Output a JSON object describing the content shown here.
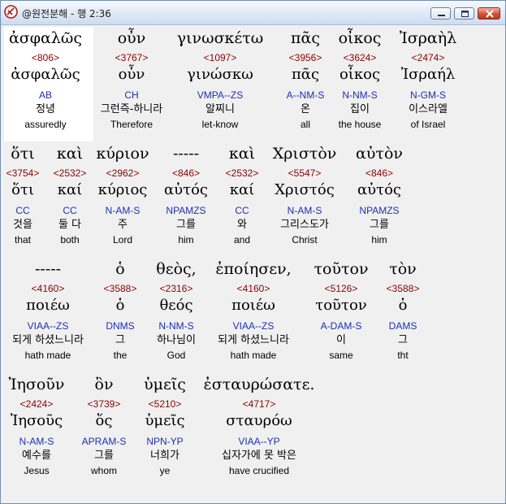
{
  "window": {
    "title": "@원전분해 - 행 2:36",
    "buttons": {
      "minimize": "minimize",
      "maximize": "maximize",
      "close": "close"
    }
  },
  "words": [
    {
      "greek": "ἀσφαλῶς",
      "strong": "<806>",
      "lexeme": "ἀσφαλῶς",
      "parse": "AB",
      "korean": "정녕",
      "english": "assuredly"
    },
    {
      "greek": "οὖν",
      "strong": "<3767>",
      "lexeme": "οὖν",
      "parse": "CH",
      "korean": "그런즉-하니라",
      "english": "Therefore"
    },
    {
      "greek": "γινωσκέτω",
      "strong": "<1097>",
      "lexeme": "γινώσκω",
      "parse": "VMPA--ZS",
      "korean": "알찌니",
      "english": "let-know"
    },
    {
      "greek": "πᾶς",
      "strong": "<3956>",
      "lexeme": "πᾶς",
      "parse": "A--NM-S",
      "korean": "온",
      "english": "all"
    },
    {
      "greek": "οἶκος",
      "strong": "<3624>",
      "lexeme": "οἶκος",
      "parse": "N-NM-S",
      "korean": "집이",
      "english": "the house"
    },
    {
      "greek": "Ἰσραὴλ",
      "strong": "<2474>",
      "lexeme": "Ἰσραήλ",
      "parse": "N-GM-S",
      "korean": "이스라엘",
      "english": "of Israel"
    },
    {
      "greek": "ὅτι",
      "strong": "<3754>",
      "lexeme": "ὅτι",
      "parse": "CC",
      "korean": "것을",
      "english": "that"
    },
    {
      "greek": "καὶ",
      "strong": "<2532>",
      "lexeme": "καί",
      "parse": "CC",
      "korean": "둘 다",
      "english": "both"
    },
    {
      "greek": "κύριον",
      "strong": "<2962>",
      "lexeme": "κύριος",
      "parse": "N-AM-S",
      "korean": "주",
      "english": "Lord"
    },
    {
      "greek": "-----",
      "strong": "<846>",
      "lexeme": "αὐτός",
      "parse": "NPAMZS",
      "korean": "그를",
      "english": "him"
    },
    {
      "greek": "καὶ",
      "strong": "<2532>",
      "lexeme": "καί",
      "parse": "CC",
      "korean": "와",
      "english": "and"
    },
    {
      "greek": "Χριστὸν",
      "strong": "<5547>",
      "lexeme": "Χριστός",
      "parse": "N-AM-S",
      "korean": "그리스도가",
      "english": "Christ"
    },
    {
      "greek": "αὐτὸν",
      "strong": "<846>",
      "lexeme": "αὐτός",
      "parse": "NPAMZS",
      "korean": "그를",
      "english": "him"
    },
    {
      "greek": "-----",
      "strong": "<4160>",
      "lexeme": "ποιέω",
      "parse": "VIAA--ZS",
      "korean": "되게 하셨느니라",
      "english": "hath made"
    },
    {
      "greek": "ὁ",
      "strong": "<3588>",
      "lexeme": "ὁ",
      "parse": "DNMS",
      "korean": "그",
      "english": "the"
    },
    {
      "greek": "θεὸς,",
      "strong": "<2316>",
      "lexeme": "θεός",
      "parse": "N-NM-S",
      "korean": "하나님이",
      "english": "God"
    },
    {
      "greek": "ἐποίησεν,",
      "strong": "<4160>",
      "lexeme": "ποιέω",
      "parse": "VIAA--ZS",
      "korean": "되게 하셨느니라",
      "english": "hath made"
    },
    {
      "greek": "τοῦτον",
      "strong": "<5126>",
      "lexeme": "τοῦτον",
      "parse": "A-DAM-S",
      "korean": "이",
      "english": "same"
    },
    {
      "greek": "τὸν",
      "strong": "<3588>",
      "lexeme": "ὁ",
      "parse": "DAMS",
      "korean": "그",
      "english": "tht"
    },
    {
      "greek": "Ἰησοῦν",
      "strong": "<2424>",
      "lexeme": "Ἰησοῦς",
      "parse": "N-AM-S",
      "korean": "예수를",
      "english": "Jesus"
    },
    {
      "greek": "ὃν",
      "strong": "<3739>",
      "lexeme": "ὅς",
      "parse": "APRAM-S",
      "korean": "그를",
      "english": "whom"
    },
    {
      "greek": "ὑμεῖς",
      "strong": "<5210>",
      "lexeme": "ὑμεῖς",
      "parse": "NPN-YP",
      "korean": "너희가",
      "english": "ye"
    },
    {
      "greek": "ἐσταυρώσατε.",
      "strong": "<4717>",
      "lexeme": "σταυρόω",
      "parse": "VIAA--YP",
      "korean": "십자가에 못 박은",
      "english": "have crucified"
    }
  ]
}
